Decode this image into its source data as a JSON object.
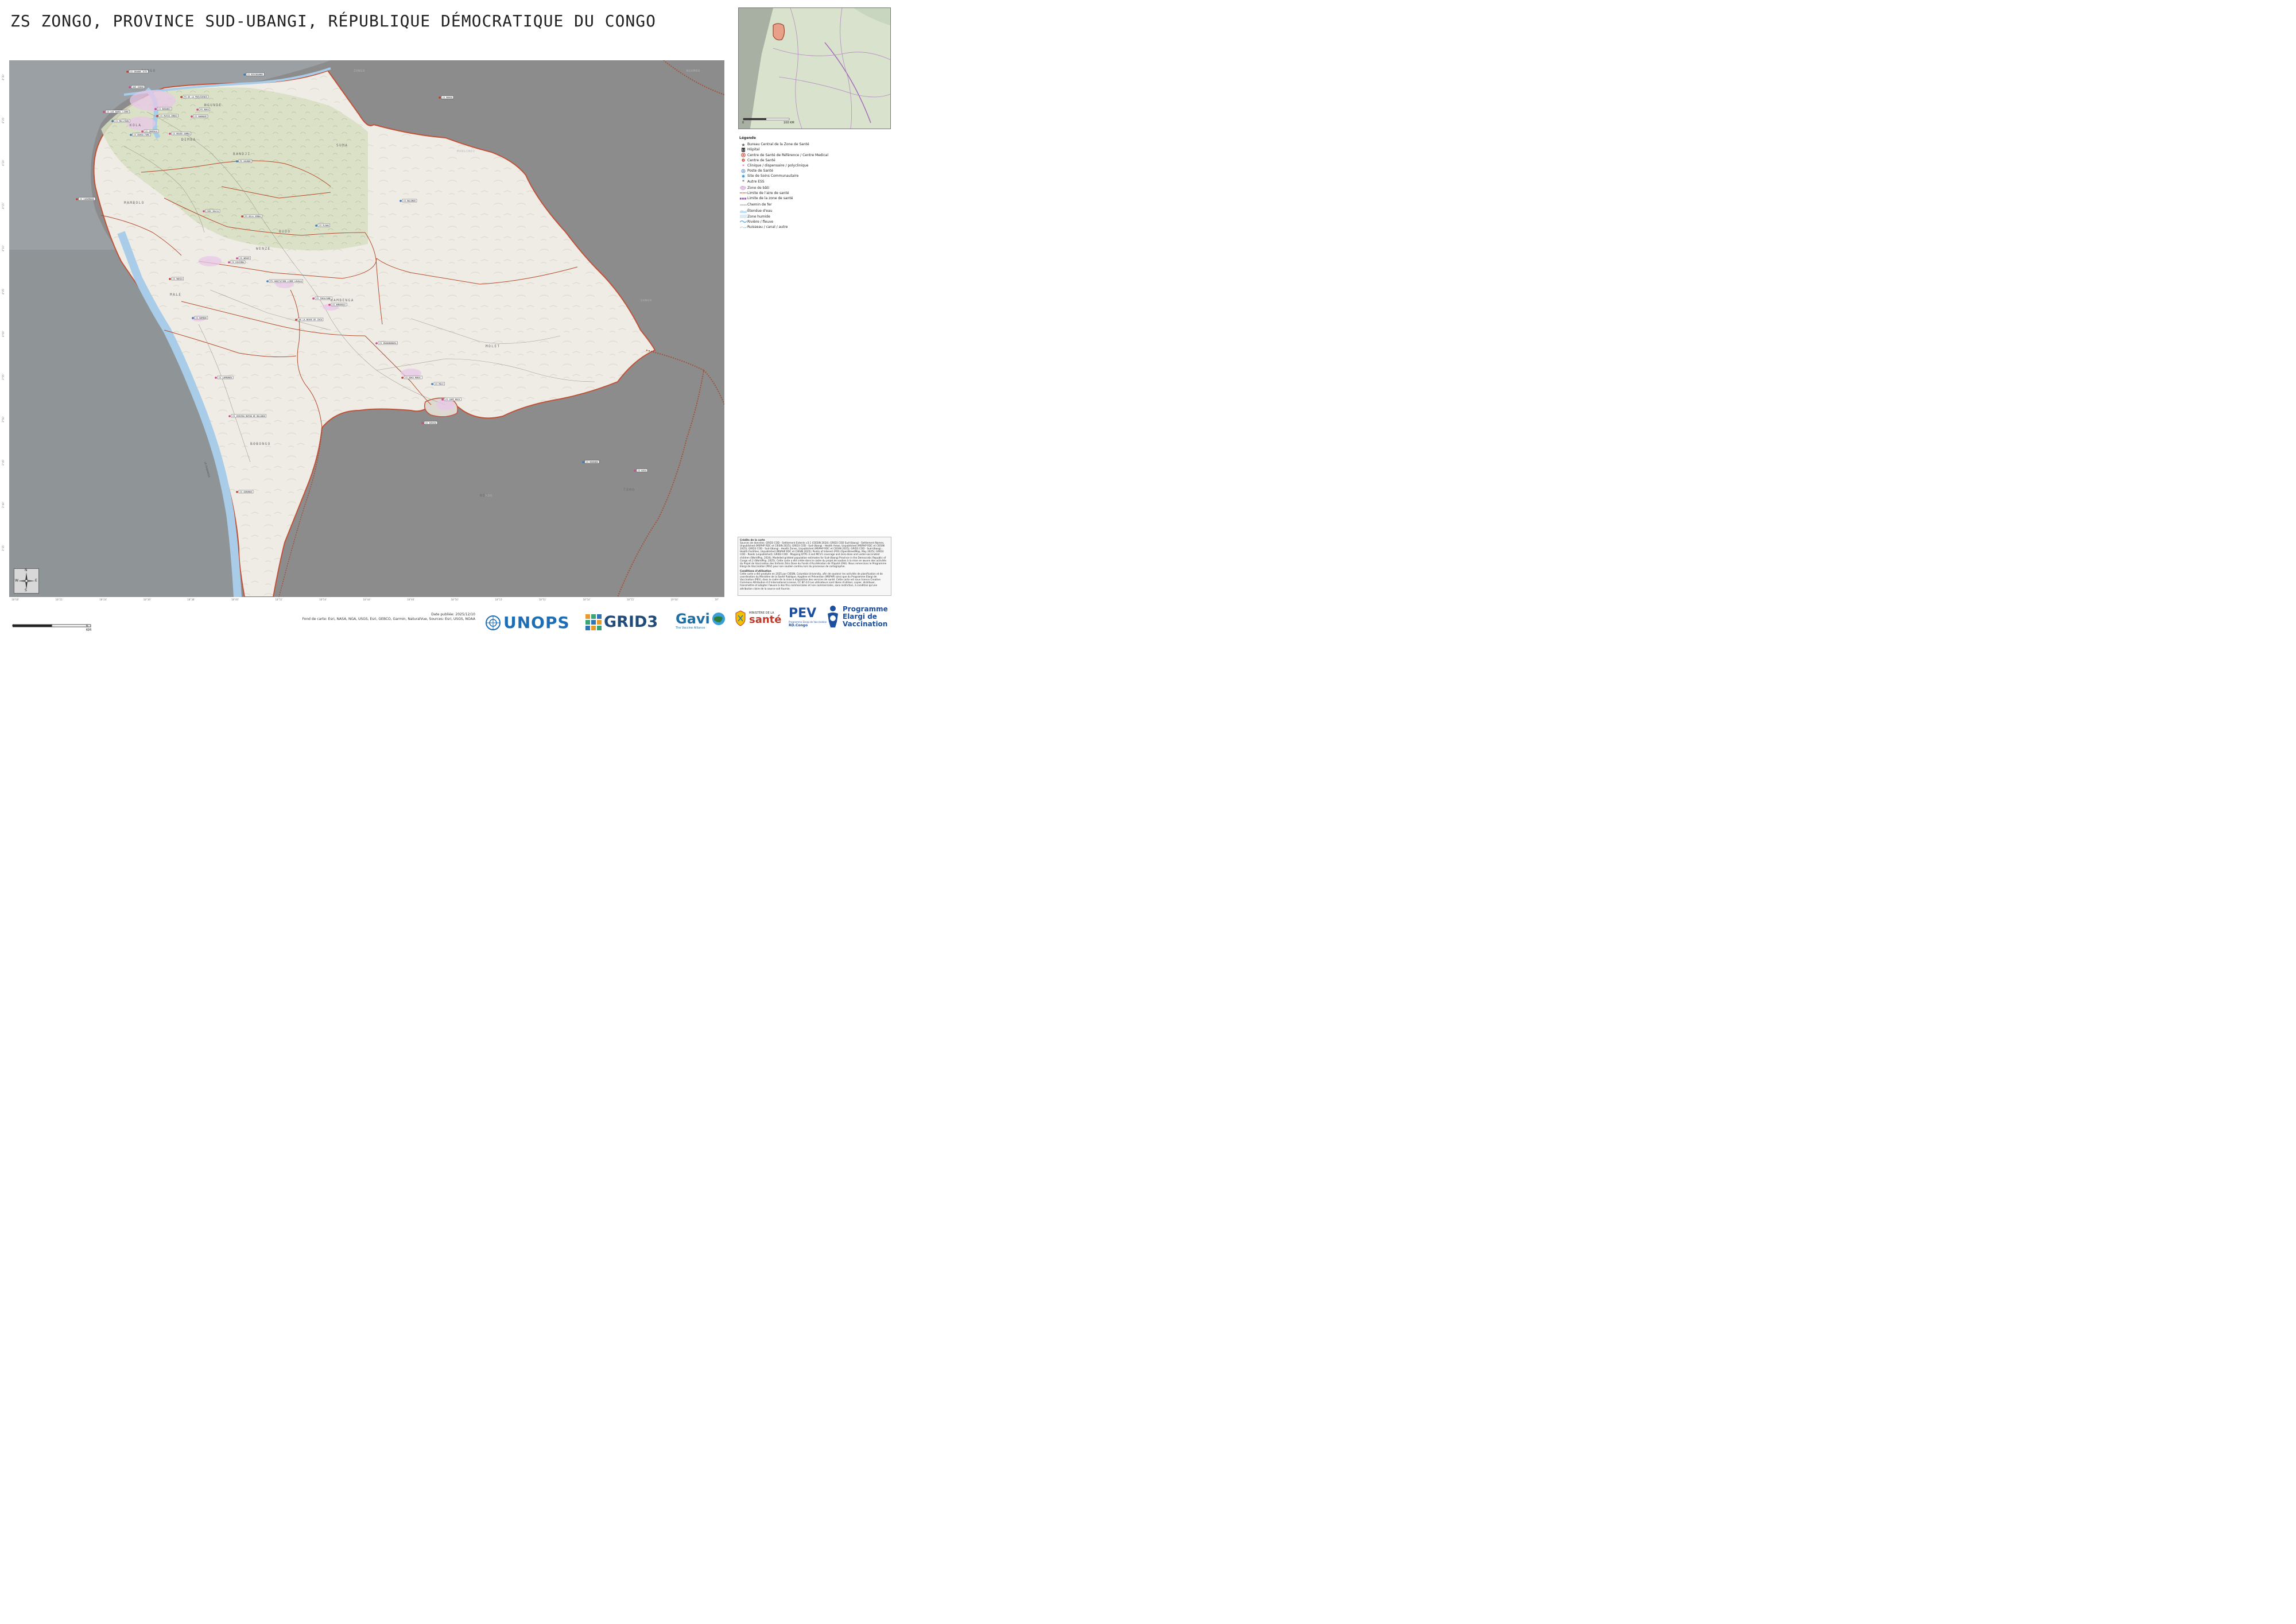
{
  "title": "ZS ZONGO, PROVINCE SUD-UBANGI, RÉPUBLIQUE DÉMOCRATIQUE DU CONGO",
  "colors": {
    "background_dark": "#8a8a8a",
    "zone_fill": "#efece6",
    "forest": "#d6dfc2",
    "river": "#a9cde8",
    "boundary_zone": "#c0523a",
    "boundary_area": "#b34a2a",
    "road": "#777777",
    "builtup": "#e8c8e8",
    "inset_highlight": "#e8a088"
  },
  "map": {
    "area_labels": [
      "NGUNDE",
      "BANDJI",
      "KOLA",
      "MAMBOLO",
      "WENZE",
      "BAMBENGA",
      "MOLET",
      "BOBONGO",
      "MALE",
      "ZONGO",
      "DIMBA",
      "SUMA",
      "BUDO",
      "NDO",
      "TOMO"
    ],
    "facility_labels": [
      "CS GRANDE ISTE",
      "CS BIRINGANDO",
      "HGR ZONGO",
      "CS LOS BAREL LIBRE",
      "PS DE LA PROVIDENCE",
      "CS MOLLYDON",
      "PS BOKO",
      "CS BOBANGI",
      "CS RUSSO-ZONGO",
      "CS DUNGU-FAMA",
      "CS BOUDO SAMBA",
      "CS GANGALA",
      "CS CABOMBOKO",
      "PS HOUNDE",
      "CS KWANAGE",
      "CSDC BALIA",
      "PS DELA SENDA",
      "CS ELAWA",
      "CS DIKIMBA",
      "CS WENZE",
      "CS MARIO",
      "PS GABITATION LIBRE LOUALA",
      "CS TOKALIANE",
      "CS AMBOKOLE",
      "DE LA NEUVE DE ZOCO",
      "CS BAMBAK",
      "CS IBONGBOBORA",
      "CS LAMBONGO",
      "CS DOKO MONIC",
      "CS MOLE",
      "CS CAMP MOCO",
      "CS JENIEKA BOPAN DE BOLANGO",
      "CS GOBONGO",
      "CS BONANDO",
      "CS KAGU",
      "CS ZURUVA",
      "CS BONGO",
      "CS BALONGO"
    ],
    "neighbor_labels": [
      "ZONGO",
      "MANGINDI",
      "NGOMBO",
      "NDO",
      "SONGO"
    ],
    "river_label": "LE OUBANGUI",
    "coords_bottom": [
      "18°00'",
      "18°21'",
      "18°24'",
      "18°36'",
      "18°38'",
      "18°40'",
      "18°51'",
      "18°54'",
      "18°44'",
      "18°46'",
      "18°50'",
      "18°53'",
      "18°51'",
      "18°54'",
      "18°55'",
      "19°00'",
      "19°"
    ],
    "coords_left": [
      "4°30'",
      "4°25'",
      "4°20'",
      "4°15'",
      "4°10'",
      "4°05'",
      "4°00'",
      "3°55'",
      "3°50'",
      "3°45'",
      "3°40'",
      "3°35'"
    ]
  },
  "north_arrow": {
    "n": "N",
    "s": "S",
    "e": "E",
    "w": "W"
  },
  "inset": {
    "scale_text": "100 KM",
    "scale_zero": "0"
  },
  "legend": {
    "title": "Légende",
    "items": [
      {
        "label": "Bureau Central de la Zone de Santé",
        "icon": "star-icon",
        "color": "#555"
      },
      {
        "label": "Hôpital",
        "icon": "hospital-icon",
        "color": "#222"
      },
      {
        "label": "Centre de Santé de Référence / Centre Medical",
        "icon": "cross-circle-icon",
        "color": "#c0392b"
      },
      {
        "label": "Centre de Santé",
        "icon": "cross-icon",
        "color": "#c0392b"
      },
      {
        "label": "Clinique / dispensaire / polyclinique",
        "icon": "asterisk-icon",
        "color": "#d0478b"
      },
      {
        "label": "Poste de Santé",
        "icon": "plus-circle-icon",
        "color": "#3a78c0"
      },
      {
        "label": "Site de Soins Communautaire",
        "icon": "sun-icon",
        "color": "#3a9fd8"
      },
      {
        "label": "Autre ESS",
        "icon": "asterisk-icon",
        "color": "#444"
      },
      {
        "label": "Zone de bâti",
        "icon": "builtup-swatch",
        "color": "#e8c8e8"
      },
      {
        "label": "Limite de l'aire de santé",
        "icon": "line-dotted-icon",
        "color": "#b34a2a"
      },
      {
        "label": "Limite de la zone de santé",
        "icon": "line-thick-icon",
        "color": "#8e3ab0"
      },
      {
        "label": "Chemin de fer",
        "icon": "rail-icon",
        "color": "#999"
      },
      {
        "label": "Étendue d'eau",
        "icon": "water-swatch",
        "color": "#bfe0f2"
      },
      {
        "label": "Zone humide",
        "icon": "wetland-swatch",
        "color": "#dcebf2"
      },
      {
        "label": "Rivière / fleuve",
        "icon": "river-icon",
        "color": "#7bb6dd"
      },
      {
        "label": "Ruisseau / canal / autre",
        "icon": "stream-icon",
        "color": "#7bb6dd"
      }
    ]
  },
  "credits": {
    "heading": "Crédits de la carte",
    "text": "Sources de données: GRID3 COD - Settlement Extents v3.1 (CIESIN 2024); GRID3 COD Sud-Ubangi - Settlement Names, Unpublished (MSPHP RDC et CIESIN 2025); GRID3 COD - Sud-Ubangi - Health Areas, Unpublished (MSPHP RDC et CIESIN 2025); GRID3 COD - Sud-Ubangi - Health Zones, Unpublished (MSPHP RDC et CIESIN 2025); GRID3 COD - Sud-Ubangi - Health Facilities, Unpublished (MSPHP RDC et CIESIN 2025); Points of Interest (POI) (OpenStreetMap, May 2025); GRID3 COD - Roads (unpublished); GRID3 COD - Mapping DTP1-3 and MCV1 coverage and zero-dose and under-vaccinated children (WorldPop, 2024); Modelled gridded population estimates for Sud-Ubangi Province in the Democratic Republic of Congo v4.2 (WorldPop, 2025). Cette carte a été créée dans le cadre du projet de soutien à la mise en œuvre des activités du Projet de Vaccination des Enfants Zéro Dose du Fonds d'Accélération de l'Équité (FAE). Nous remercions le Programme Elargi de Vaccination (PEV) pour son soutien continu lors du processus de cartographie.",
    "conditions_heading": "Conditions d'utilisation",
    "conditions": "Cette carte a été produite en 2025 par CIESIN, Columbia University, afin de soutenir les activités de planification et de coordination du Ministère de la Santé Publique, Hygiène et Prévention (MSPHP) ainsi que du Programme Elargi de Vaccination (PEV), dans le cadre de la mise à disposition des services de santé. Cette carte est sous licence Creative Commons Attribution 4.0 International License, CC BY 4.0 Les utilisateurs sont libres d'utiliser, copier, distribuer, transmettre et adapter l'œuvre à des fins commerciales et non commerciales, sans restriction, à condition qu'une attribution claire de la source soit fournie."
  },
  "scalebar": {
    "labels": [
      "0",
      "3",
      "6 KM"
    ]
  },
  "footer": {
    "date": "Date publiée: 2025/12/10",
    "basemap": "Fond de carte: Esri, NASA, NGA, USGS, Esri, GEBCO, Garmin, NaturalVue, Sources: Esri, USGS, NOAA"
  },
  "logos": {
    "unops": "UNOPS",
    "grid3": "GRID3",
    "gavi": "Gavi",
    "gavi_sub": "The Vaccine Alliance",
    "ministere": "MINISTÈRE DE LA",
    "sante": "santé",
    "pev": "PEV",
    "pev_sub1": "Programme Elargi de Vaccination",
    "pev_sub2": "RD.Congo",
    "programme1": "Programme",
    "programme2": "Elargi de",
    "programme3": "Vaccination"
  }
}
